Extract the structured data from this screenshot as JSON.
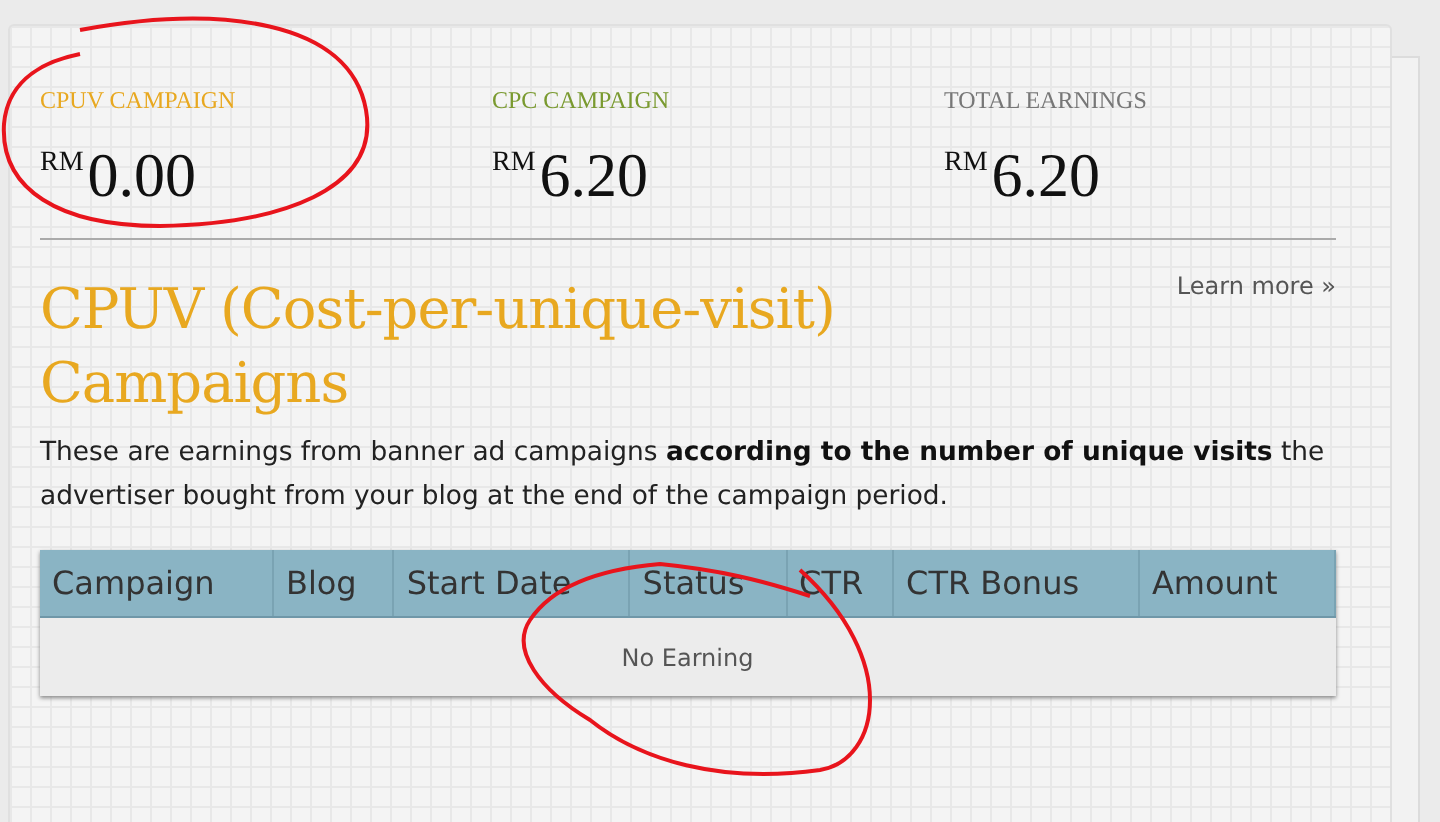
{
  "stats": [
    {
      "label": "CPUV CAMPAIGN",
      "currency": "RM",
      "amount": "0.00",
      "color": "#e8a820"
    },
    {
      "label": "CPC CAMPAIGN",
      "currency": "RM",
      "amount": "6.20",
      "color": "#7a9a30"
    },
    {
      "label": "TOTAL EARNINGS",
      "currency": "RM",
      "amount": "6.20",
      "color": "#777777"
    }
  ],
  "section": {
    "title": "CPUV (Cost-per-unique-visit) Campaigns",
    "link": "Learn more »",
    "description": "These are earnings from banner ad campaigns **according to the number of unique visits** the advertiser bought from your blog at the end of the campaign period."
  },
  "table": {
    "columns": [
      "Campaign",
      "Blog",
      "Start Date",
      "Status",
      "CTR",
      "CTR Bonus",
      "Amount"
    ],
    "empty_message": "No Earning"
  }
}
